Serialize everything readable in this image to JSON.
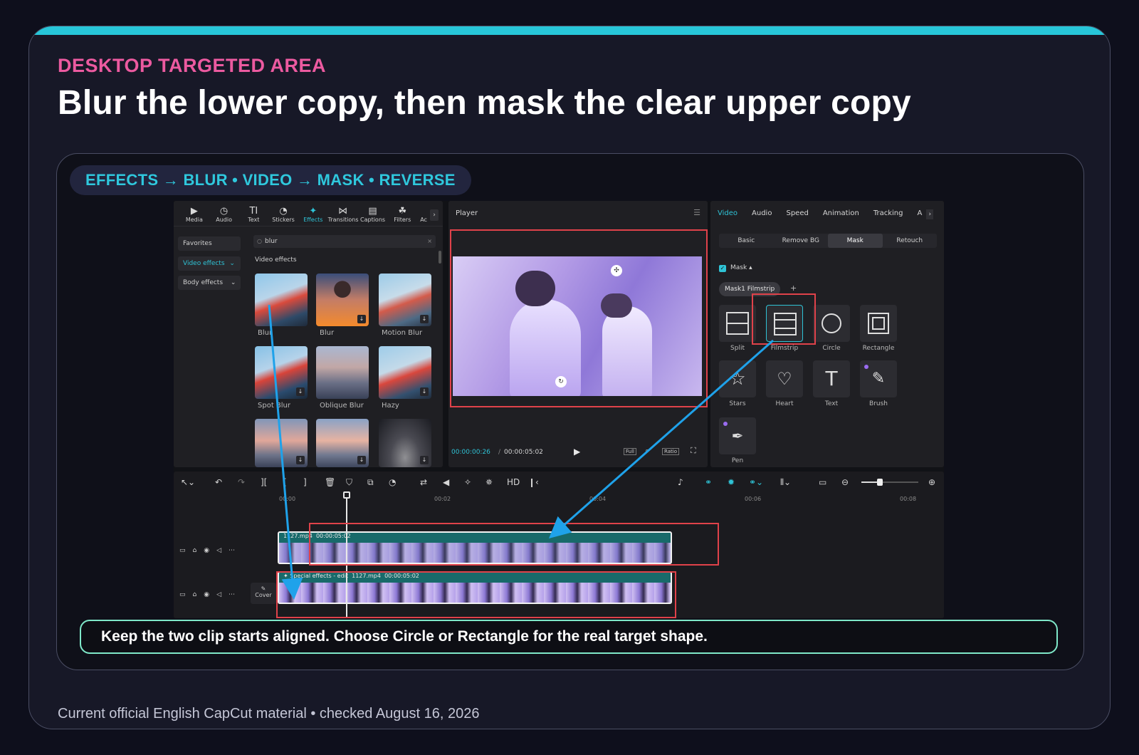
{
  "slide": {
    "kicker": "DESKTOP TARGETED AREA",
    "title": "Blur the lower copy, then mask the clear upper copy",
    "path_pill": "EFFECTS → BLUR • VIDEO → MASK • REVERSE",
    "note": "Keep the two clip starts aligned. Choose Circle or Rectangle for the real target shape.",
    "footer": "Current official English CapCut material • checked August 16, 2026"
  },
  "colors": {
    "accent": "#27c6d9",
    "kicker": "#ec5aa0",
    "highlight": "#e0424a",
    "arrow": "#1fa2ea",
    "note_border": "#7fe8c9"
  },
  "app": {
    "toolbar_tabs": [
      {
        "label": "Media",
        "icon": "▶"
      },
      {
        "label": "Audio",
        "icon": "◷"
      },
      {
        "label": "Text",
        "icon": "TI"
      },
      {
        "label": "Stickers",
        "icon": "◔"
      },
      {
        "label": "Effects",
        "icon": "✦",
        "active": true
      },
      {
        "label": "Transitions",
        "icon": "⋈"
      },
      {
        "label": "Captions",
        "icon": "▤"
      },
      {
        "label": "Filters",
        "icon": "☘"
      },
      {
        "label": "Ac",
        "icon": ""
      }
    ],
    "sidebar": [
      "Favorites",
      "Video effects",
      "Body effects"
    ],
    "search_value": "blur",
    "section_title": "Video effects",
    "effects": [
      "Blur",
      "Blur",
      "Motion Blur",
      "Spot Blur",
      "Oblique Blur",
      "Hazy",
      "",
      "",
      ""
    ],
    "player": {
      "title": "Player",
      "time_current": "00:00:00:26",
      "time_total": "00:00:05:02",
      "full_label": "Full",
      "ratio_label": "Ratio"
    },
    "inspector": {
      "tabs": [
        "Video",
        "Audio",
        "Speed",
        "Animation",
        "Tracking",
        "A"
      ],
      "subtabs": [
        "Basic",
        "Remove BG",
        "Mask",
        "Retouch"
      ],
      "mask_label": "Mask",
      "mask_item": "Mask1 Filmstrip",
      "shapes": [
        "Split",
        "Filmstrip",
        "Circle",
        "Rectangle",
        "Stars",
        "Heart",
        "Text",
        "Brush",
        "Pen"
      ]
    },
    "timeline": {
      "ruler": [
        "00:00",
        "00:02",
        "00:04",
        "00:06",
        "00:08"
      ],
      "upper_clip": {
        "name": "1127.mp4",
        "duration": "00:00:05:02"
      },
      "lower_clip": {
        "effect": "Special effects - edit",
        "name": "1127.mp4",
        "duration": "00:00:05:02"
      },
      "cover_label": "Cover"
    }
  }
}
